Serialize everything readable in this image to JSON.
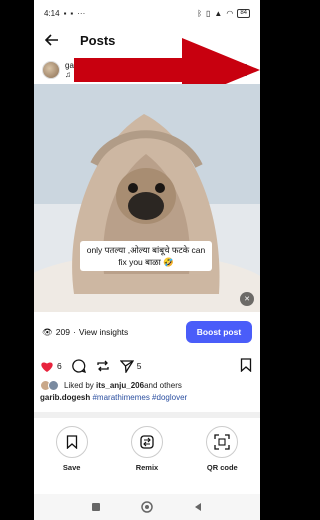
{
  "status_bar": {
    "time": "4:14",
    "left_icons": [
      "image-icon",
      "image-icon",
      "dots-icon"
    ],
    "right_icons": [
      "bluetooth-icon",
      "vibrate-icon",
      "signal-icon",
      "wifi-icon"
    ],
    "battery": "84"
  },
  "header": {
    "title": "Posts"
  },
  "post": {
    "username_fragment": "ga",
    "caption_overlay": "only पतल्या ,ओल्या बांबूचे फटके can fix you बाळा 🤣",
    "views": "209",
    "view_insights_label": "View insights",
    "boost_label": "Boost post"
  },
  "actions": {
    "likes": "6",
    "shares": "5"
  },
  "liked_by": {
    "prefix": "Liked by ",
    "user": "its_anju_206",
    "suffix": " and others"
  },
  "caption": {
    "user": "garib.dogesh",
    "tags": "#marathimemes #doglover"
  },
  "tools": [
    {
      "label": "Save",
      "icon": "bookmark-icon"
    },
    {
      "label": "Remix",
      "icon": "remix-icon"
    },
    {
      "label": "QR code",
      "icon": "qr-code-icon"
    }
  ],
  "colors": {
    "accent": "#4a5df9",
    "like": "#e8233d",
    "annotation_arrow": "#c8000f",
    "hashtag": "#2b4fa0"
  }
}
